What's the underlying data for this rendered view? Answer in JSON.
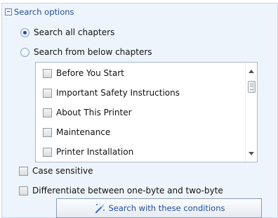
{
  "search_options": {
    "title": "Search options",
    "radios": [
      {
        "label": "Search all chapters",
        "checked": true
      },
      {
        "label": "Search from below chapters",
        "checked": false
      }
    ],
    "chapters": [
      "Before You Start",
      "Important Safety Instructions",
      "About This Printer",
      "Maintenance",
      "Printer Installation"
    ],
    "options": [
      {
        "label": "Case sensitive",
        "checked": false
      },
      {
        "label": "Differentiate between one-byte and two-byte",
        "checked": false
      }
    ],
    "search_button_label": "Search with these conditions",
    "accent_color": "#1f4fa0"
  },
  "icons": {
    "collapse": "minus-box-icon",
    "search_button": "magic-wand-search-icon"
  }
}
